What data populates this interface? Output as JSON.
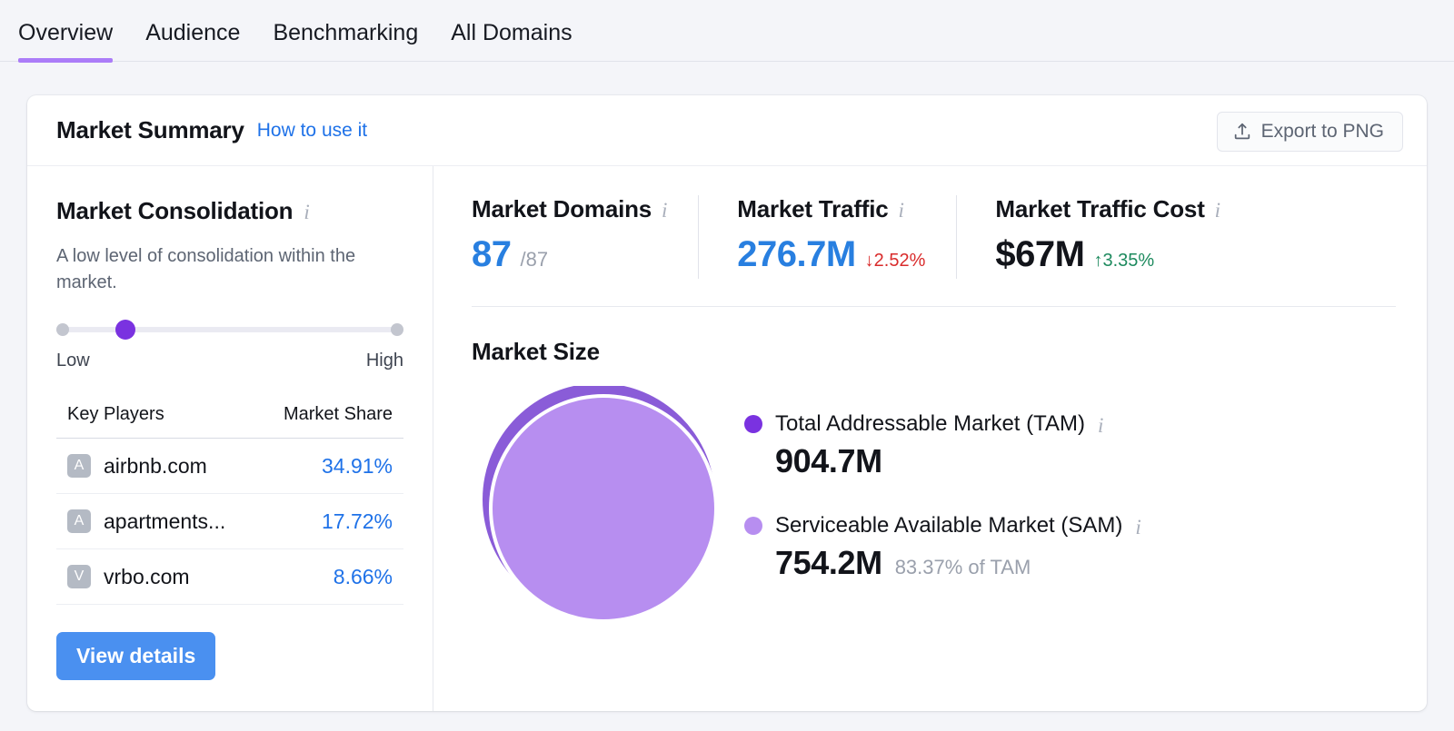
{
  "tabs": [
    {
      "label": "Overview",
      "active": true
    },
    {
      "label": "Audience",
      "active": false
    },
    {
      "label": "Benchmarking",
      "active": false
    },
    {
      "label": "All Domains",
      "active": false
    }
  ],
  "card": {
    "title": "Market Summary",
    "how_link": "How to use it",
    "export_label": "Export to PNG",
    "export_icon": "upload-icon"
  },
  "consolidation": {
    "title": "Market Consolidation",
    "info_icon": "info-icon",
    "description": "A low level of consolidation within the market.",
    "slider": {
      "value_percent": 17,
      "low_label": "Low",
      "high_label": "High"
    },
    "table": {
      "columns": [
        "Key Players",
        "Market Share"
      ],
      "rows": [
        {
          "initial": "A",
          "domain": "airbnb.com",
          "share": "34.91%"
        },
        {
          "initial": "A",
          "domain": "apartments...",
          "share": "17.72%"
        },
        {
          "initial": "V",
          "domain": "vrbo.com",
          "share": "8.66%"
        }
      ]
    },
    "view_details_label": "View details"
  },
  "metrics": [
    {
      "label": "Market Domains",
      "info_icon": "info-icon",
      "value": "87",
      "value_color": "blue",
      "suffix": "/87",
      "delta": "",
      "delta_dir": ""
    },
    {
      "label": "Market Traffic",
      "info_icon": "info-icon",
      "value": "276.7M",
      "value_color": "blue",
      "suffix": "",
      "delta": "↓2.52%",
      "delta_dir": "down"
    },
    {
      "label": "Market Traffic Cost",
      "info_icon": "info-icon",
      "value": "$67M",
      "value_color": "dark",
      "suffix": "",
      "delta": "↑3.35%",
      "delta_dir": "up"
    }
  ],
  "market_size": {
    "title": "Market Size",
    "legend": [
      {
        "label": "Total Addressable Market (TAM)",
        "info_icon": "info-icon",
        "value": "904.7M",
        "note": "",
        "color": "#7a32e0"
      },
      {
        "label": "Serviceable Available Market (SAM)",
        "info_icon": "info-icon",
        "value": "754.2M",
        "note": "83.37% of TAM",
        "color": "#b78ef0"
      }
    ]
  },
  "chart_data": {
    "type": "pie",
    "title": "Market Size",
    "categories": [
      "Total Addressable Market (TAM)",
      "Serviceable Available Market (SAM)"
    ],
    "values": [
      904.7,
      754.2
    ],
    "value_labels": [
      "904.7M",
      "754.2M"
    ],
    "units": "visits",
    "ratio_sam_of_tam": 83.37,
    "ratio_label": "83.37% of TAM",
    "colors": [
      "#8a5cd8",
      "#b78ef0"
    ],
    "legend_position": "right",
    "grid": false,
    "note": "Nested proportional circles: outer circle = TAM, inner circle = SAM"
  },
  "colors": {
    "accent_purple": "#ab7cf8",
    "link_blue": "#1f72e8",
    "value_blue": "#287fe0",
    "positive_green": "#1d8a5e",
    "negative_red": "#d92b2b",
    "tam_purple": "#8a5cd8",
    "sam_purple": "#b78ef0",
    "page_bg": "#f4f5f9"
  }
}
